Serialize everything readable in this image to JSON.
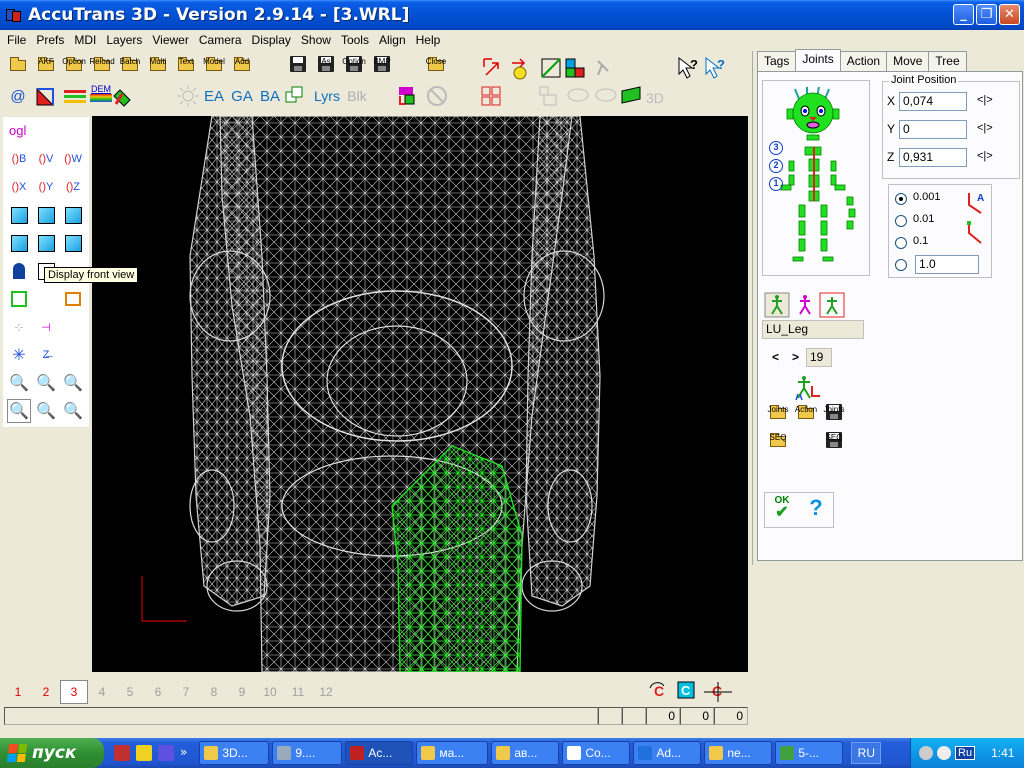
{
  "window": {
    "title": "AccuTrans 3D - Version 2.9.14 - [3.WRL]",
    "minimize": "_",
    "restore": "❐",
    "close": "✕"
  },
  "menu": [
    "File",
    "Prefs",
    "MDI",
    "Layers",
    "Viewer",
    "Camera",
    "Display",
    "Show",
    "Tools",
    "Align",
    "Help"
  ],
  "toolbar": {
    "row1": {
      "akf": "AKF",
      "option": "Option",
      "reload": "Reload",
      "batch": "Batch",
      "multi": "Multi",
      "text": "Text",
      "model": "Model",
      "add": "Add",
      "as": "As",
      "option2": "Option",
      "bmp": "BMP",
      "close": "Close"
    },
    "row2": {
      "at": "@",
      "dem": "DEM",
      "ea": "EA",
      "ga": "GA",
      "ba": "BA",
      "lyrs": "Lyrs",
      "blks": "Blk",
      "s3d": "3D"
    }
  },
  "toolbox": {
    "ogl": "ogl",
    "row1": [
      "B",
      "V",
      "W"
    ],
    "row2": [
      "X",
      "Y",
      "Z"
    ],
    "tooltip": "Display front view"
  },
  "panel": {
    "tabs": [
      "Tags",
      "Joints",
      "Action",
      "Move",
      "Tree"
    ],
    "active_tab": "Joints",
    "joint_position": {
      "legend": "Joint Position",
      "x_label": "X",
      "x_value": "0,074",
      "y_label": "Y",
      "y_value": "0",
      "z_label": "Z",
      "z_value": "0,931",
      "nudge": "<|>"
    },
    "steps": {
      "o1": "0.001",
      "o2": "0.01",
      "o3": "0.1",
      "custom": "1.0"
    },
    "skeleton_markers": [
      "3",
      "2",
      "1"
    ],
    "joint_name": "LU_Leg",
    "nav_prev": "<",
    "nav_next": ">",
    "joint_index": "19",
    "buttons": {
      "joints_open": "Joints",
      "action_open": "Action",
      "joints_save": "Joints",
      "seq_open": "SEQ",
      "seq_save": "SEQ",
      "ok": "OK",
      "help": "?"
    }
  },
  "pages": {
    "items": [
      "1",
      "2",
      "3",
      "4",
      "5",
      "6",
      "7",
      "8",
      "9",
      "10",
      "11",
      "12"
    ],
    "active": "3"
  },
  "status": {
    "v1": "0",
    "v2": "0",
    "v3": "0"
  },
  "taskbar": {
    "start": "пуск",
    "tasks": [
      "3D...",
      "9....",
      "Ac...",
      "ма...",
      "ав...",
      "Co...",
      "Ad...",
      "ne...",
      "5-..."
    ],
    "lang": "RU",
    "tray_lang": "Ru",
    "clock": "1:41"
  },
  "colors": {
    "title_bar": "#0553d6",
    "wireframe": "#d0d0d0",
    "selected_wireframe": "#22e022",
    "viewport_bg": "#000000",
    "start_button": "#2f8f32"
  }
}
